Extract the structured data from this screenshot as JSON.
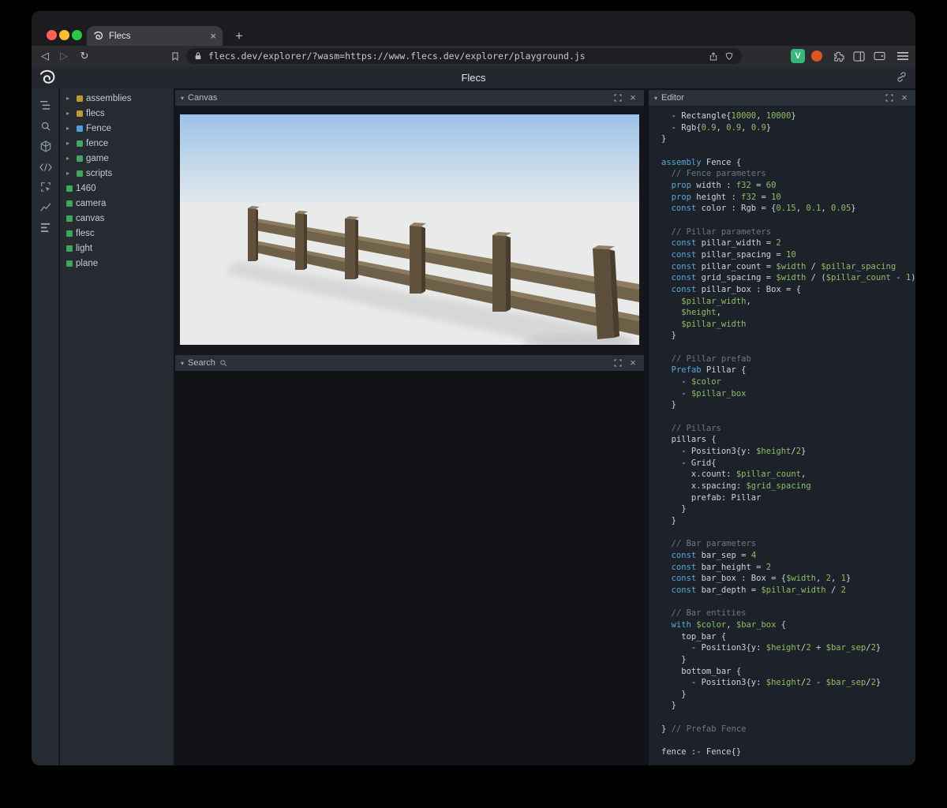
{
  "browser": {
    "tab": {
      "title": "Flecs",
      "close_glyph": "×",
      "new_tab_glyph": "+"
    },
    "nav": {
      "back_glyph": "◁",
      "forward_glyph": "▷",
      "reload_glyph": "↻"
    },
    "url": "flecs.dev/explorer/?wasm=https://www.flecs.dev/explorer/playground.js",
    "profile_badge": "V"
  },
  "header": {
    "title": "Flecs"
  },
  "sidebar": {
    "icons": [
      "entities-tree",
      "search",
      "3d-cube",
      "code",
      "inspect",
      "chart",
      "stats"
    ]
  },
  "tree": {
    "arrow_glyph": "▸",
    "colors": {
      "module": "#c2992e",
      "prefab": "#4f9ce0",
      "entity": "#3fa65c"
    },
    "items": [
      {
        "label": "assemblies",
        "color": "#c2992e",
        "expandable": true
      },
      {
        "label": "flecs",
        "color": "#c2992e",
        "expandable": true
      },
      {
        "label": "Fence",
        "color": "#4f9ce0",
        "expandable": true
      },
      {
        "label": "fence",
        "color": "#3fa65c",
        "expandable": true
      },
      {
        "label": "game",
        "color": "#3fa65c",
        "expandable": true
      },
      {
        "label": "scripts",
        "color": "#3fa65c",
        "expandable": true
      },
      {
        "label": "1460",
        "color": "#3fa65c",
        "expandable": false
      },
      {
        "label": "camera",
        "color": "#3fa65c",
        "expandable": false
      },
      {
        "label": "canvas",
        "color": "#3fa65c",
        "expandable": false
      },
      {
        "label": "flesc",
        "color": "#3fa65c",
        "expandable": false
      },
      {
        "label": "light",
        "color": "#3fa65c",
        "expandable": false
      },
      {
        "label": "plane",
        "color": "#3fa65c",
        "expandable": false
      }
    ]
  },
  "panels": {
    "chevron_glyph": "▾",
    "close_glyph": "×",
    "canvas": {
      "title": "Canvas"
    },
    "search": {
      "title": "Search"
    },
    "editor": {
      "title": "Editor"
    }
  },
  "editor": {
    "token_colors": {
      "k": "#57a8d8",
      "g": "#8fbe63",
      "c": "#6d7680",
      "d": "#ced4da"
    },
    "code_lines": [
      [
        [
          "d",
          "  - Rectangle{"
        ],
        [
          "g",
          "10000"
        ],
        [
          "d",
          ", "
        ],
        [
          "g",
          "10000"
        ],
        [
          "d",
          "}"
        ]
      ],
      [
        [
          "d",
          "  - Rgb{"
        ],
        [
          "g",
          "0.9"
        ],
        [
          "d",
          ", "
        ],
        [
          "g",
          "0.9"
        ],
        [
          "d",
          ", "
        ],
        [
          "g",
          "0.9"
        ],
        [
          "d",
          "}"
        ]
      ],
      [
        [
          "d",
          "}"
        ]
      ],
      [],
      [
        [
          "k",
          "assembly"
        ],
        [
          "d",
          " Fence {"
        ]
      ],
      [
        [
          "c",
          "  // Fence parameters"
        ]
      ],
      [
        [
          "d",
          "  "
        ],
        [
          "k",
          "prop"
        ],
        [
          "d",
          " width : "
        ],
        [
          "g",
          "f32"
        ],
        [
          "d",
          " = "
        ],
        [
          "g",
          "60"
        ]
      ],
      [
        [
          "d",
          "  "
        ],
        [
          "k",
          "prop"
        ],
        [
          "d",
          " height : "
        ],
        [
          "g",
          "f32"
        ],
        [
          "d",
          " = "
        ],
        [
          "g",
          "10"
        ]
      ],
      [
        [
          "d",
          "  "
        ],
        [
          "k",
          "const"
        ],
        [
          "d",
          " color : Rgb = {"
        ],
        [
          "g",
          "0.15"
        ],
        [
          "d",
          ", "
        ],
        [
          "g",
          "0.1"
        ],
        [
          "d",
          ", "
        ],
        [
          "g",
          "0.05"
        ],
        [
          "d",
          "}"
        ]
      ],
      [],
      [
        [
          "c",
          "  // Pillar parameters"
        ]
      ],
      [
        [
          "d",
          "  "
        ],
        [
          "k",
          "const"
        ],
        [
          "d",
          " pillar_width = "
        ],
        [
          "g",
          "2"
        ]
      ],
      [
        [
          "d",
          "  "
        ],
        [
          "k",
          "const"
        ],
        [
          "d",
          " pillar_spacing = "
        ],
        [
          "g",
          "10"
        ]
      ],
      [
        [
          "d",
          "  "
        ],
        [
          "k",
          "const"
        ],
        [
          "d",
          " pillar_count = "
        ],
        [
          "g",
          "$width"
        ],
        [
          "d",
          " / "
        ],
        [
          "g",
          "$pillar_spacing"
        ]
      ],
      [
        [
          "d",
          "  "
        ],
        [
          "k",
          "const"
        ],
        [
          "d",
          " grid_spacing = "
        ],
        [
          "g",
          "$width"
        ],
        [
          "d",
          " / ("
        ],
        [
          "g",
          "$pillar_count"
        ],
        [
          "d",
          " - "
        ],
        [
          "g",
          "1"
        ],
        [
          "d",
          ")"
        ]
      ],
      [
        [
          "d",
          "  "
        ],
        [
          "k",
          "const"
        ],
        [
          "d",
          " pillar_box : Box = {"
        ]
      ],
      [
        [
          "d",
          "    "
        ],
        [
          "g",
          "$pillar_width"
        ],
        [
          "d",
          ","
        ]
      ],
      [
        [
          "d",
          "    "
        ],
        [
          "g",
          "$height"
        ],
        [
          "d",
          ","
        ]
      ],
      [
        [
          "d",
          "    "
        ],
        [
          "g",
          "$pillar_width"
        ]
      ],
      [
        [
          "d",
          "  }"
        ]
      ],
      [],
      [
        [
          "c",
          "  // Pillar prefab"
        ]
      ],
      [
        [
          "d",
          "  "
        ],
        [
          "k",
          "Prefab"
        ],
        [
          "d",
          " Pillar {"
        ]
      ],
      [
        [
          "d",
          "    - "
        ],
        [
          "g",
          "$color"
        ]
      ],
      [
        [
          "d",
          "    - "
        ],
        [
          "g",
          "$pillar_box"
        ]
      ],
      [
        [
          "d",
          "  }"
        ]
      ],
      [],
      [
        [
          "c",
          "  // Pillars"
        ]
      ],
      [
        [
          "d",
          "  pillars {"
        ]
      ],
      [
        [
          "d",
          "    - Position3{y: "
        ],
        [
          "g",
          "$height"
        ],
        [
          "d",
          "/"
        ],
        [
          "g",
          "2"
        ],
        [
          "d",
          "}"
        ]
      ],
      [
        [
          "d",
          "    - Grid{"
        ]
      ],
      [
        [
          "d",
          "      x.count: "
        ],
        [
          "g",
          "$pillar_count"
        ],
        [
          "d",
          ","
        ]
      ],
      [
        [
          "d",
          "      x.spacing: "
        ],
        [
          "g",
          "$grid_spacing"
        ]
      ],
      [
        [
          "d",
          "      prefab: Pillar"
        ]
      ],
      [
        [
          "d",
          "    }"
        ]
      ],
      [
        [
          "d",
          "  }"
        ]
      ],
      [],
      [
        [
          "c",
          "  // Bar parameters"
        ]
      ],
      [
        [
          "d",
          "  "
        ],
        [
          "k",
          "const"
        ],
        [
          "d",
          " bar_sep = "
        ],
        [
          "g",
          "4"
        ]
      ],
      [
        [
          "d",
          "  "
        ],
        [
          "k",
          "const"
        ],
        [
          "d",
          " bar_height = "
        ],
        [
          "g",
          "2"
        ]
      ],
      [
        [
          "d",
          "  "
        ],
        [
          "k",
          "const"
        ],
        [
          "d",
          " bar_box : Box = {"
        ],
        [
          "g",
          "$width"
        ],
        [
          "d",
          ", "
        ],
        [
          "g",
          "2"
        ],
        [
          "d",
          ", "
        ],
        [
          "g",
          "1"
        ],
        [
          "d",
          "}"
        ]
      ],
      [
        [
          "d",
          "  "
        ],
        [
          "k",
          "const"
        ],
        [
          "d",
          " bar_depth = "
        ],
        [
          "g",
          "$pillar_width"
        ],
        [
          "d",
          " / "
        ],
        [
          "g",
          "2"
        ]
      ],
      [],
      [
        [
          "c",
          "  // Bar entities"
        ]
      ],
      [
        [
          "d",
          "  "
        ],
        [
          "k",
          "with"
        ],
        [
          "d",
          " "
        ],
        [
          "g",
          "$color"
        ],
        [
          "d",
          ", "
        ],
        [
          "g",
          "$bar_box"
        ],
        [
          "d",
          " {"
        ]
      ],
      [
        [
          "d",
          "    top_bar {"
        ]
      ],
      [
        [
          "d",
          "      - Position3{y: "
        ],
        [
          "g",
          "$height"
        ],
        [
          "d",
          "/"
        ],
        [
          "g",
          "2"
        ],
        [
          "d",
          " + "
        ],
        [
          "g",
          "$bar_sep"
        ],
        [
          "d",
          "/"
        ],
        [
          "g",
          "2"
        ],
        [
          "d",
          "}"
        ]
      ],
      [
        [
          "d",
          "    }"
        ]
      ],
      [
        [
          "d",
          "    bottom_bar {"
        ]
      ],
      [
        [
          "d",
          "      - Position3{y: "
        ],
        [
          "g",
          "$height"
        ],
        [
          "d",
          "/"
        ],
        [
          "g",
          "2"
        ],
        [
          "d",
          " - "
        ],
        [
          "g",
          "$bar_sep"
        ],
        [
          "d",
          "/"
        ],
        [
          "g",
          "2"
        ],
        [
          "d",
          "}"
        ]
      ],
      [
        [
          "d",
          "    }"
        ]
      ],
      [
        [
          "d",
          "  }"
        ]
      ],
      [],
      [
        [
          "d",
          "} "
        ],
        [
          "c",
          "// Prefab Fence"
        ]
      ],
      [],
      [
        [
          "d",
          "fence :- Fence{}"
        ]
      ]
    ]
  }
}
